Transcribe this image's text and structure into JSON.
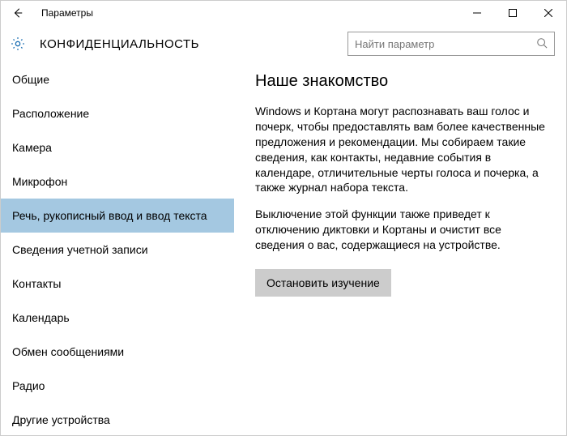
{
  "titlebar": {
    "title": "Параметры"
  },
  "header": {
    "heading": "КОНФИДЕНЦИАЛЬНОСТЬ",
    "search_placeholder": "Найти параметр"
  },
  "sidebar": {
    "items": [
      {
        "label": "Общие",
        "selected": false
      },
      {
        "label": "Расположение",
        "selected": false
      },
      {
        "label": "Камера",
        "selected": false
      },
      {
        "label": "Микрофон",
        "selected": false
      },
      {
        "label": "Речь, рукописный ввод и ввод текста",
        "selected": true
      },
      {
        "label": "Сведения учетной записи",
        "selected": false
      },
      {
        "label": "Контакты",
        "selected": false
      },
      {
        "label": "Календарь",
        "selected": false
      },
      {
        "label": "Обмен сообщениями",
        "selected": false
      },
      {
        "label": "Радио",
        "selected": false
      },
      {
        "label": "Другие устройства",
        "selected": false
      }
    ]
  },
  "main": {
    "heading": "Наше знакомство",
    "para1": "Windows и Кортана могут распознавать ваш голос и почерк, чтобы предоставлять вам более качественные предложения и рекомендации. Мы собираем такие сведения, как контакты, недавние события в календаре, отличительные черты голоса и почерка, а также журнал набора текста.",
    "para2": "Выключение этой функции также приведет к отключению диктовки и Кортаны и очистит все сведения о вас, содержащиеся на устройстве.",
    "button_label": "Остановить изучение"
  }
}
